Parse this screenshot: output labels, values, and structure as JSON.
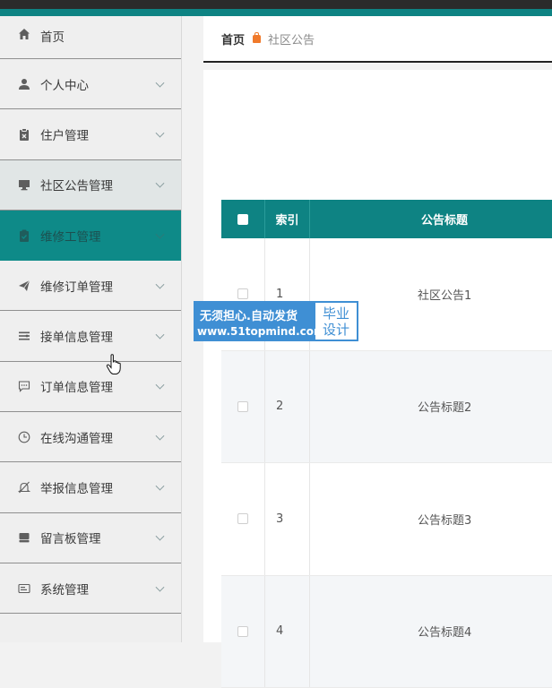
{
  "breadcrumb": {
    "home": "首页",
    "current": "社区公告"
  },
  "sidebar": {
    "items": [
      {
        "label": "首页",
        "icon": "home-icon"
      },
      {
        "label": "个人中心",
        "icon": "user-icon"
      },
      {
        "label": "住户管理",
        "icon": "clipboard-icon"
      },
      {
        "label": "社区公告管理",
        "icon": "monitor-icon"
      },
      {
        "label": "维修工管理",
        "icon": "clipboard-check-icon"
      },
      {
        "label": "维修订单管理",
        "icon": "send-icon"
      },
      {
        "label": "接单信息管理",
        "icon": "list-icon"
      },
      {
        "label": "订单信息管理",
        "icon": "message-icon"
      },
      {
        "label": "在线沟通管理",
        "icon": "clock-icon"
      },
      {
        "label": "举报信息管理",
        "icon": "bell-off-icon"
      },
      {
        "label": "留言板管理",
        "icon": "inbox-icon"
      },
      {
        "label": "系统管理",
        "icon": "id-card-icon"
      }
    ],
    "active_index": 4,
    "hover_index": 3
  },
  "table": {
    "headers": [
      "索引",
      "公告标题"
    ],
    "rows": [
      {
        "index": "1",
        "title": "社区公告1"
      },
      {
        "index": "2",
        "title": "公告标题2"
      },
      {
        "index": "3",
        "title": "公告标题3"
      },
      {
        "index": "4",
        "title": "公告标题4"
      }
    ]
  },
  "watermark": {
    "line1": "无须担心.自动发货",
    "line2": "www.51topmind.com",
    "right_top": "毕业",
    "right_bottom": "设计"
  },
  "colors": {
    "accent": "#0e8383",
    "header_dark": "#2b2b2b",
    "watermark_blue": "#3f8fd4",
    "breadcrumb_icon": "#f07a2b"
  }
}
